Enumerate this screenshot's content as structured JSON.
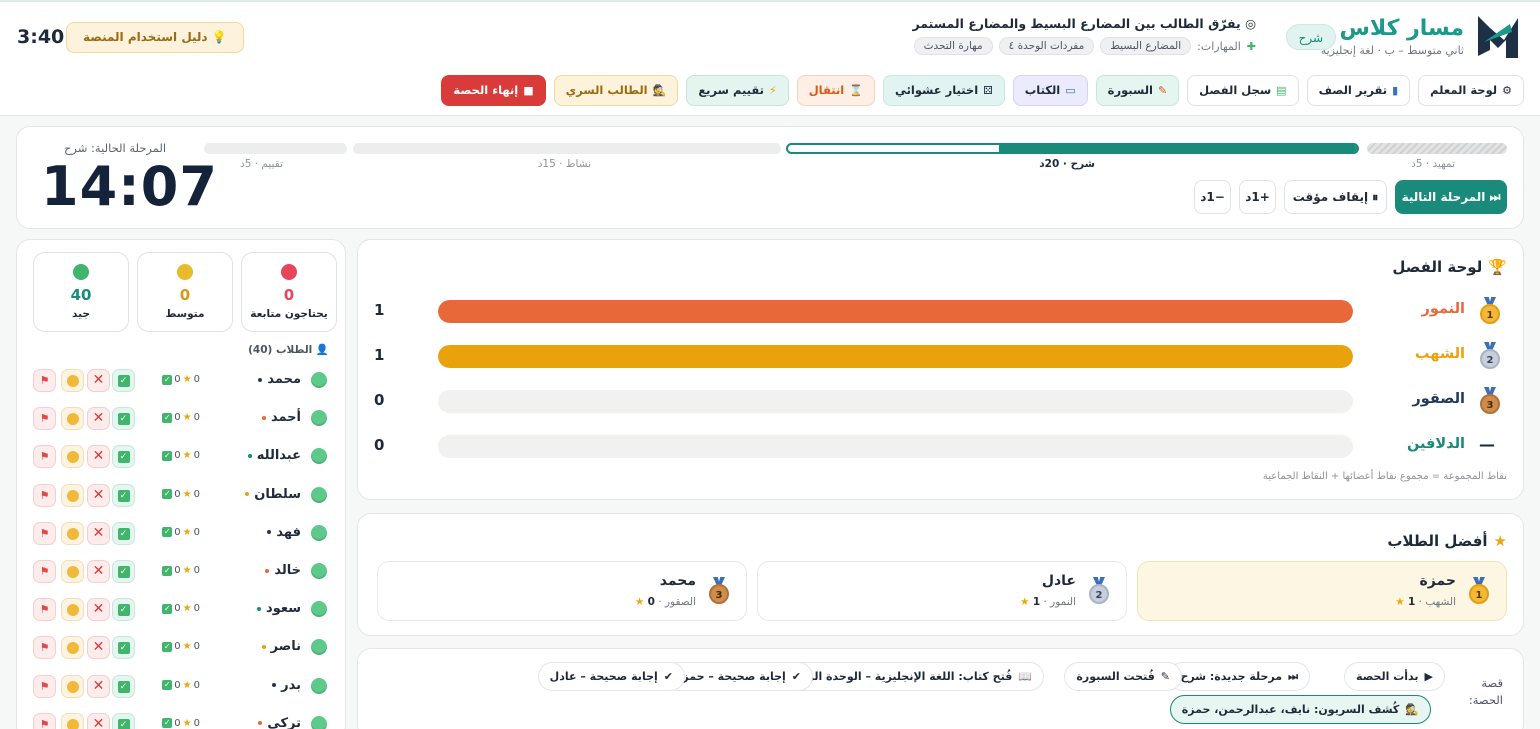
{
  "header": {
    "brand_name_1": "مسار",
    "brand_name_2": "كلاس",
    "class_info": "ثاني متوسط – ب · لغة إنجليزية",
    "mode_pill": "شرح",
    "objective": "يفرّق الطالب بين المضارع البسيط والمضارع المستمر",
    "skills_label": "المهارات:",
    "skills": [
      "المضارع البسيط",
      "مفردات الوحدة ٤",
      "مهارة التحدث"
    ],
    "guide_button": "دليل استخدام المنصة",
    "clock": "3:40"
  },
  "toolbar": {
    "teacher_dashboard": "لوحة المعلم",
    "class_report": "تقرير الصف",
    "class_log": "سجل الفصل",
    "whiteboard": "السبورة",
    "book": "الكتاب",
    "random_pick": "اختيار عشوائي",
    "transition": "انتقال",
    "quick_assessment": "تقييم سريع",
    "secret_student": "الطالب السري",
    "end_session": "إنهاء الحصة"
  },
  "phases": {
    "current_label": "المرحلة الحالية: شرح",
    "timer": "14:07",
    "stages": [
      {
        "name": "تمهيد · 5د",
        "state": "done"
      },
      {
        "name": "شرح · 20د",
        "state": "active",
        "progress": 0.63
      },
      {
        "name": "نشاط · 15د",
        "state": "pending"
      },
      {
        "name": "تقييم · 5د",
        "state": "pending"
      }
    ],
    "next_button": "المرحلة التالية",
    "pause_button": "إيقاف مؤقت",
    "plus_button": "+1د",
    "minus_button": "−1د"
  },
  "leaderboard": {
    "title": "لوحة الفصل",
    "max_score": 1,
    "teams": [
      {
        "rank": "1",
        "name": "النمور",
        "score": 1,
        "score_label": "1",
        "color": "#e8683a"
      },
      {
        "rank": "2",
        "name": "الشهب",
        "score": 1,
        "score_label": "1",
        "color": "#eaa20c"
      },
      {
        "rank": "3",
        "name": "الصقور",
        "score": 0,
        "score_label": "0",
        "color": "#1e3a5a"
      },
      {
        "rank": "—",
        "name": "الدلافين",
        "score": 0,
        "score_label": "0",
        "color": "#1a8a7a"
      }
    ],
    "note": "نقاط المجموعة = مجموع نقاط أعضائها + النقاط الجماعية"
  },
  "top_students": {
    "title": "أفضل الطلاب",
    "items": [
      {
        "rank": "1",
        "name": "حمزة",
        "team": "الشهب",
        "points": "1"
      },
      {
        "rank": "2",
        "name": "عادل",
        "team": "النمور",
        "points": "1"
      },
      {
        "rank": "3",
        "name": "محمد",
        "team": "الصقور",
        "points": "0"
      }
    ]
  },
  "story": {
    "label": "قصة الحصة:",
    "events": [
      {
        "icon": "▶",
        "text": "بدأت الحصة"
      },
      {
        "icon": "⏭",
        "text": "مرحلة جديدة: شرح"
      },
      {
        "icon": "✎",
        "text": "فُتحت السبورة"
      },
      {
        "icon": "📖",
        "text": "فُتح كتاب: اللغة الإنجليزية – الوحدة الرابعة"
      },
      {
        "icon": "✔",
        "text": "إجابة صحيحة – حمزة"
      },
      {
        "icon": "✔",
        "text": "إجابة صحيحة – عادل"
      },
      {
        "icon": "🕵",
        "text": "كُشف السريون: نايف، عبدالرحمن، حمزة"
      }
    ]
  },
  "students_panel": {
    "stats": [
      {
        "value": "0",
        "label": "يحتاجون متابعة",
        "color": "#e8455a"
      },
      {
        "value": "0",
        "label": "متوسط",
        "color": "#eab92c"
      },
      {
        "value": "40",
        "label": "جيد",
        "color": "#3fb66b"
      }
    ],
    "list_title": "الطلاب (40)",
    "students": [
      {
        "name": "محمد",
        "team_color": "#1e3a5a",
        "stars": "0",
        "correct": "0"
      },
      {
        "name": "أحمد",
        "team_color": "#e8683a",
        "stars": "0",
        "correct": "0"
      },
      {
        "name": "عبدالله",
        "team_color": "#1a8a7a",
        "stars": "0",
        "correct": "0"
      },
      {
        "name": "سلطان",
        "team_color": "#eaa20c",
        "stars": "0",
        "correct": "0"
      },
      {
        "name": "فهد",
        "team_color": "#1e3a5a",
        "stars": "0",
        "correct": "0"
      },
      {
        "name": "خالد",
        "team_color": "#e8683a",
        "stars": "0",
        "correct": "0"
      },
      {
        "name": "سعود",
        "team_color": "#1a8a7a",
        "stars": "0",
        "correct": "0"
      },
      {
        "name": "ناصر",
        "team_color": "#eaa20c",
        "stars": "0",
        "correct": "0"
      },
      {
        "name": "بدر",
        "team_color": "#1e3a5a",
        "stars": "0",
        "correct": "0"
      },
      {
        "name": "تركي",
        "team_color": "#e8683a",
        "stars": "0",
        "correct": "0"
      }
    ]
  }
}
